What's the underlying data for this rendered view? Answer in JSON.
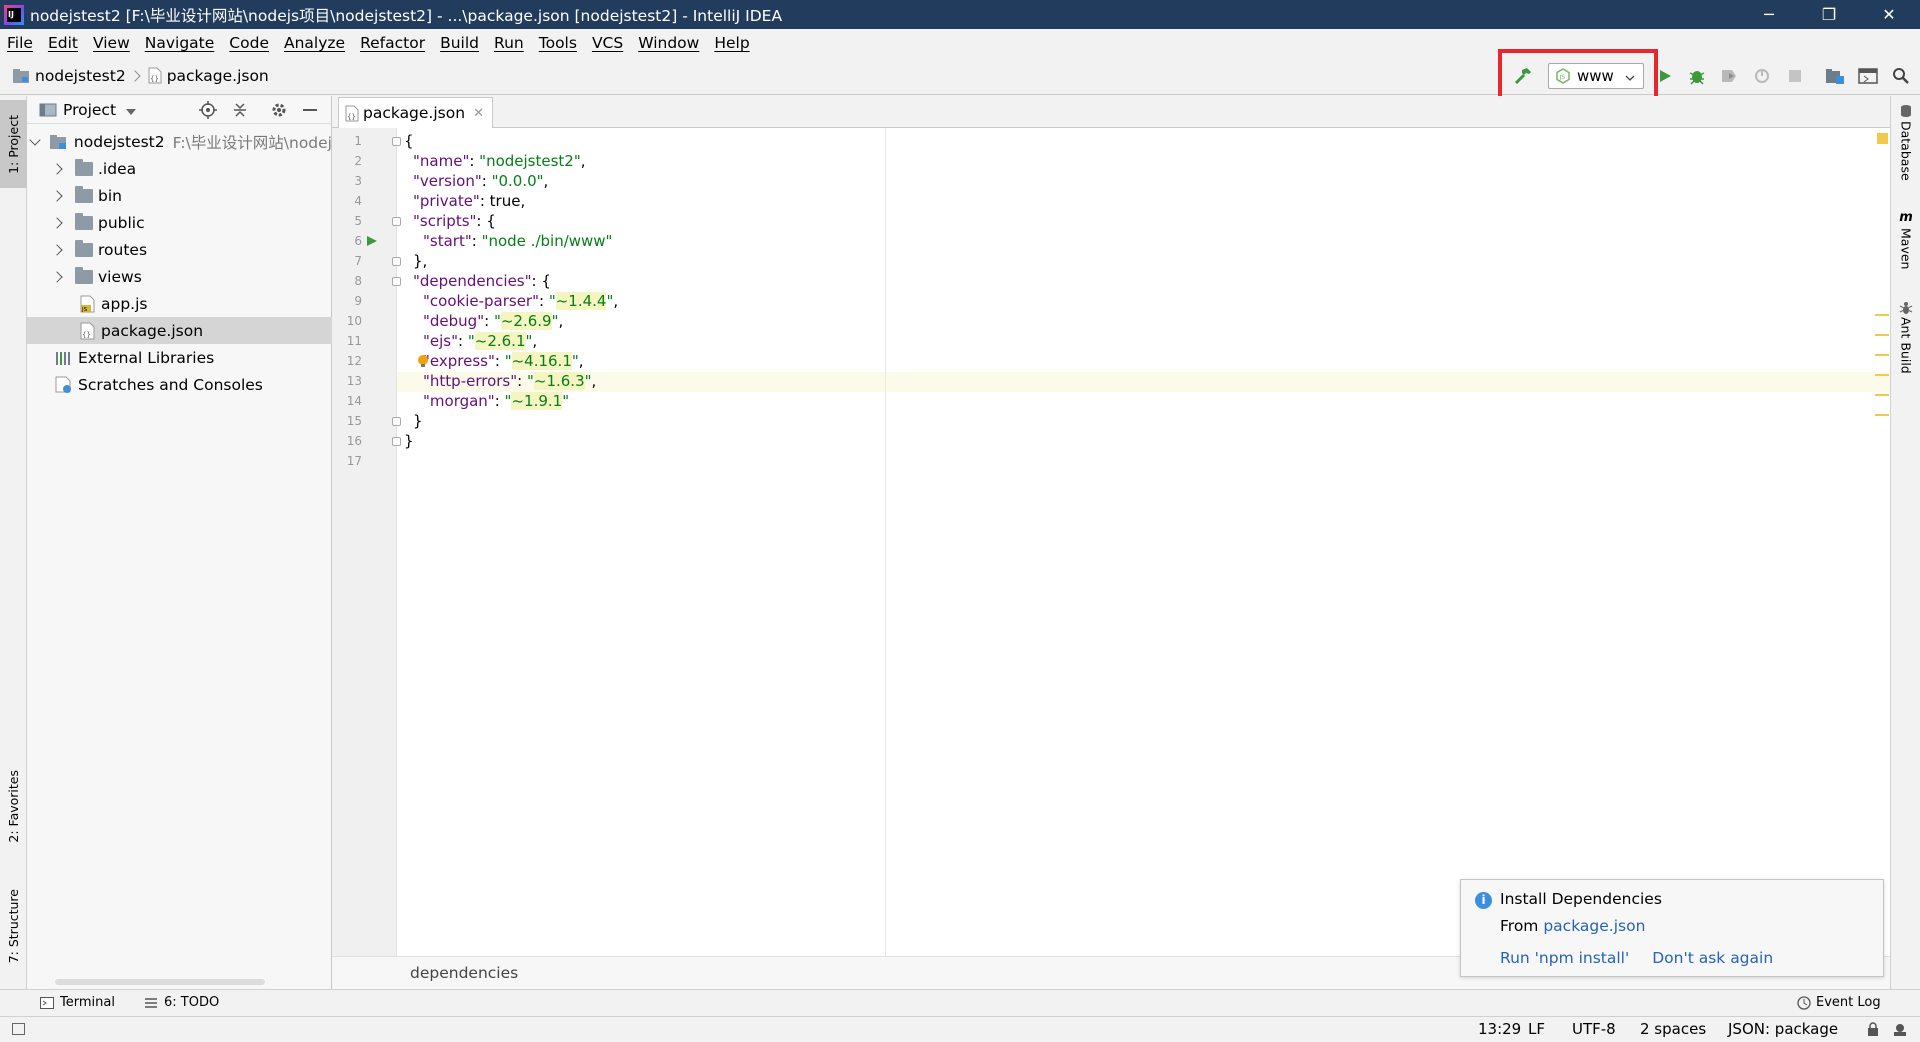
{
  "window": {
    "title": "nodejstest2 [F:\\毕业设计网站\\nodejs项目\\nodejstest2] - ...\\package.json [nodejstest2] - IntelliJ IDEA",
    "app_icon": "IJ",
    "controls": {
      "minimize": "─",
      "restore": "❐",
      "close": "✕"
    }
  },
  "menu": [
    "File",
    "Edit",
    "View",
    "Navigate",
    "Code",
    "Analyze",
    "Refactor",
    "Build",
    "Run",
    "Tools",
    "VCS",
    "Window",
    "Help"
  ],
  "breadcrumb": {
    "project": "nodejstest2",
    "file": "package.json"
  },
  "toolbar": {
    "run_config": "www"
  },
  "left_tabs": {
    "project": "1: Project",
    "favorites": "2: Favorites",
    "structure": "7: Structure"
  },
  "project_panel": {
    "title": "Project",
    "root": {
      "name": "nodejstest2",
      "path": "F:\\毕业设计网站\\nodej"
    },
    "items": [
      {
        "label": ".idea",
        "type": "folder"
      },
      {
        "label": "bin",
        "type": "folder"
      },
      {
        "label": "public",
        "type": "folder"
      },
      {
        "label": "routes",
        "type": "folder"
      },
      {
        "label": "views",
        "type": "folder"
      },
      {
        "label": "app.js",
        "type": "js"
      },
      {
        "label": "package.json",
        "type": "json"
      }
    ],
    "external_libraries": "External Libraries",
    "scratches": "Scratches and Consoles"
  },
  "editor": {
    "tab": "package.json",
    "line_numbers": [
      "1",
      "2",
      "3",
      "4",
      "5",
      "6",
      "7",
      "8",
      "9",
      "10",
      "11",
      "12",
      "13",
      "14",
      "15",
      "16",
      "17"
    ],
    "code": {
      "l1": "{",
      "l2_key": "\"name\"",
      "l2_val": "\"nodejstest2\"",
      "l3_key": "\"version\"",
      "l3_val": "\"0.0.0\"",
      "l4_key": "\"private\"",
      "l4_val": "true",
      "l5_key": "\"scripts\"",
      "l6_key": "\"start\"",
      "l6_val": "\"node ./bin/www\"",
      "l7": "},",
      "l8_key": "\"dependencies\"",
      "l9_key": "\"cookie-parser\"",
      "l9_val": "~1.4.4",
      "l10_key": "\"debug\"",
      "l10_val": "~2.6.9",
      "l11_key": "\"ejs\"",
      "l11_val": "~2.6.1",
      "l12_key": "\"express\"",
      "l12_val": "~4.16.1",
      "l13_key": "\"http-errors\"",
      "l13_val": "~1.6.3",
      "l14_key": "\"morgan\"",
      "l14_val": "~1.9.1",
      "l15": "}",
      "l16": "}"
    },
    "breadcrumb": "dependencies"
  },
  "right_tabs": {
    "database": "Database",
    "maven": "Maven",
    "ant": "Ant Build"
  },
  "notification": {
    "title": "Install Dependencies",
    "from_label": "From",
    "from_link": "package.json",
    "action1": "Run 'npm install'",
    "action2": "Don't ask again"
  },
  "bottom_tools": {
    "terminal": "Terminal",
    "todo": "6: TODO",
    "event_log": "Event Log"
  },
  "status": {
    "position": "13:29",
    "line_sep": "LF",
    "encoding": "UTF-8",
    "indent": "2 spaces",
    "schema": "JSON: package"
  },
  "colors": {
    "title_bg": "#213c5c",
    "highlight": "#e8262e",
    "key": "#660e7a",
    "string": "#067d17",
    "link": "#2563b8"
  }
}
